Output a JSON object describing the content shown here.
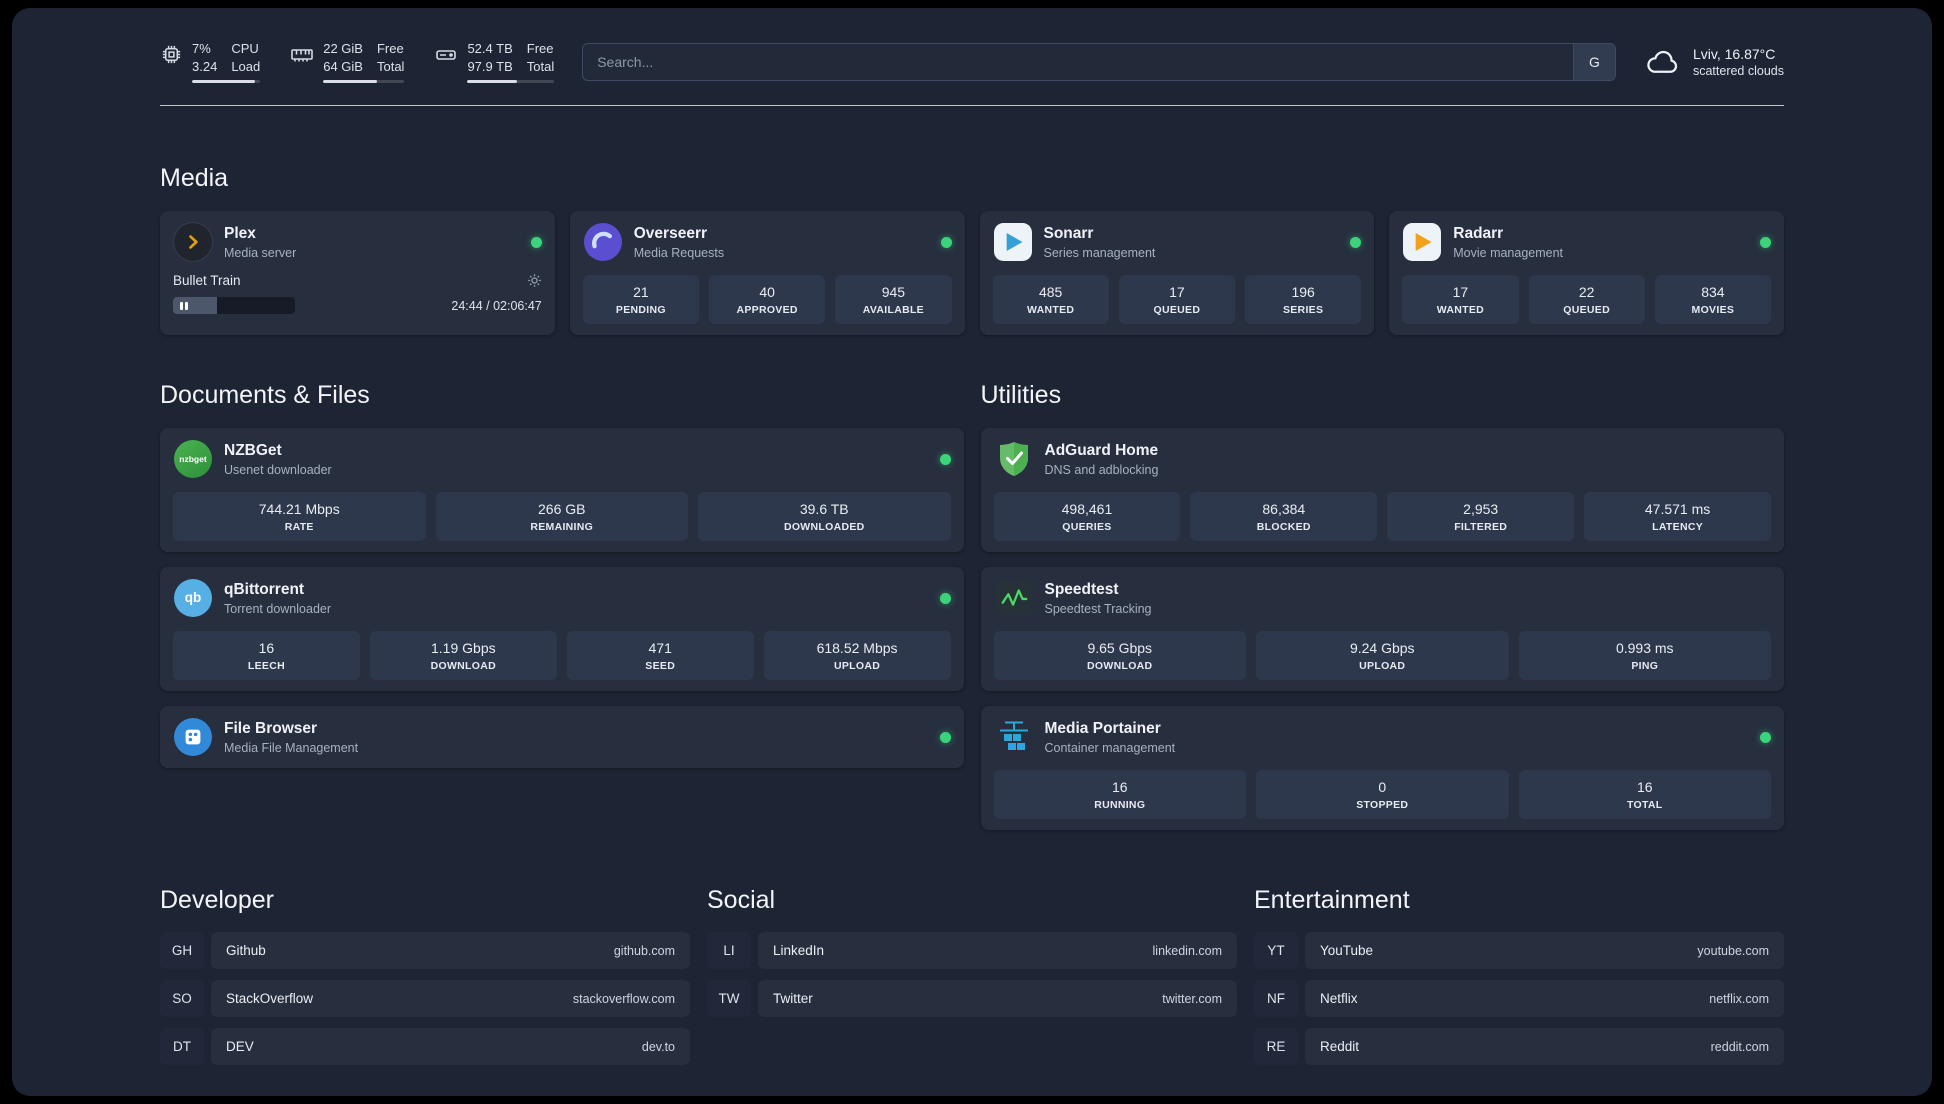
{
  "colors": {
    "status_online": "#3bd47a",
    "background": "#1d2433",
    "card": "#272f3f",
    "tile": "#2e384c"
  },
  "topbar": {
    "cpu": {
      "value_line1": "7%",
      "value_line2": "3.24",
      "label_line1": "CPU",
      "label_line2": "Load",
      "progress_pct": 93
    },
    "ram": {
      "value_line1": "22 GiB",
      "value_line2": "64 GiB",
      "label_line1": "Free",
      "label_line2": "Total",
      "progress_pct": 66
    },
    "disk": {
      "value_line1": "52.4 TB",
      "value_line2": "97.9 TB",
      "label_line1": "Free",
      "label_line2": "Total",
      "progress_pct": 57
    },
    "search": {
      "placeholder": "Search...",
      "button_label": "G"
    },
    "weather": {
      "location": "Lviv, 16.87°C",
      "condition": "scattered clouds"
    }
  },
  "media": {
    "heading": "Media",
    "plex": {
      "name": "Plex",
      "subtitle": "Media server",
      "now_playing": "Bullet Train",
      "time": "24:44 / 02:06:47",
      "progress_pct": 36
    },
    "overseerr": {
      "name": "Overseerr",
      "subtitle": "Media Requests",
      "stats": [
        {
          "value": "21",
          "label": "PENDING"
        },
        {
          "value": "40",
          "label": "APPROVED"
        },
        {
          "value": "945",
          "label": "AVAILABLE"
        }
      ]
    },
    "sonarr": {
      "name": "Sonarr",
      "subtitle": "Series management",
      "stats": [
        {
          "value": "485",
          "label": "WANTED"
        },
        {
          "value": "17",
          "label": "QUEUED"
        },
        {
          "value": "196",
          "label": "SERIES"
        }
      ]
    },
    "radarr": {
      "name": "Radarr",
      "subtitle": "Movie management",
      "stats": [
        {
          "value": "17",
          "label": "WANTED"
        },
        {
          "value": "22",
          "label": "QUEUED"
        },
        {
          "value": "834",
          "label": "MOVIES"
        }
      ]
    }
  },
  "documents": {
    "heading": "Documents & Files",
    "nzbget": {
      "name": "NZBGet",
      "subtitle": "Usenet downloader",
      "icon_text": "nzbget",
      "stats": [
        {
          "value": "744.21 Mbps",
          "label": "RATE"
        },
        {
          "value": "266 GB",
          "label": "REMAINING"
        },
        {
          "value": "39.6 TB",
          "label": "DOWNLOADED"
        }
      ]
    },
    "qbittorrent": {
      "name": "qBittorrent",
      "subtitle": "Torrent downloader",
      "icon_text": "qb",
      "stats": [
        {
          "value": "16",
          "label": "LEECH"
        },
        {
          "value": "1.19 Gbps",
          "label": "DOWNLOAD"
        },
        {
          "value": "471",
          "label": "SEED"
        },
        {
          "value": "618.52 Mbps",
          "label": "UPLOAD"
        }
      ]
    },
    "filebrowser": {
      "name": "File Browser",
      "subtitle": "Media File Management"
    }
  },
  "utilities": {
    "heading": "Utilities",
    "adguard": {
      "name": "AdGuard Home",
      "subtitle": "DNS and adblocking",
      "stats": [
        {
          "value": "498,461",
          "label": "QUERIES"
        },
        {
          "value": "86,384",
          "label": "BLOCKED"
        },
        {
          "value": "2,953",
          "label": "FILTERED"
        },
        {
          "value": "47.571 ms",
          "label": "LATENCY"
        }
      ]
    },
    "speedtest": {
      "name": "Speedtest",
      "subtitle": "Speedtest Tracking",
      "stats": [
        {
          "value": "9.65 Gbps",
          "label": "DOWNLOAD"
        },
        {
          "value": "9.24 Gbps",
          "label": "UPLOAD"
        },
        {
          "value": "0.993 ms",
          "label": "PING"
        }
      ]
    },
    "portainer": {
      "name": "Media Portainer",
      "subtitle": "Container management",
      "stats": [
        {
          "value": "16",
          "label": "RUNNING"
        },
        {
          "value": "0",
          "label": "STOPPED"
        },
        {
          "value": "16",
          "label": "TOTAL"
        }
      ]
    }
  },
  "bookmarks": {
    "developer": {
      "heading": "Developer",
      "links": [
        {
          "abbr": "GH",
          "name": "Github",
          "domain": "github.com"
        },
        {
          "abbr": "SO",
          "name": "StackOverflow",
          "domain": "stackoverflow.com"
        },
        {
          "abbr": "DT",
          "name": "DEV",
          "domain": "dev.to"
        }
      ]
    },
    "social": {
      "heading": "Social",
      "links": [
        {
          "abbr": "LI",
          "name": "LinkedIn",
          "domain": "linkedin.com"
        },
        {
          "abbr": "TW",
          "name": "Twitter",
          "domain": "twitter.com"
        }
      ]
    },
    "entertainment": {
      "heading": "Entertainment",
      "links": [
        {
          "abbr": "YT",
          "name": "YouTube",
          "domain": "youtube.com"
        },
        {
          "abbr": "NF",
          "name": "Netflix",
          "domain": "netflix.com"
        },
        {
          "abbr": "RE",
          "name": "Reddit",
          "domain": "reddit.com"
        }
      ]
    }
  }
}
